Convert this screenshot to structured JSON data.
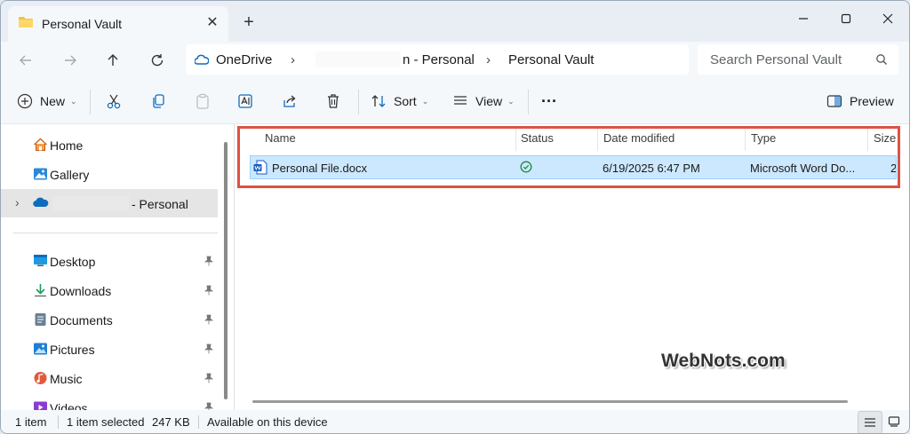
{
  "window": {
    "tab_title": "Personal Vault",
    "tab_close": "✕",
    "new_tab": "+",
    "controls": {
      "minimize": "minimize-icon",
      "maximize": "maximize-icon",
      "close": "close-icon"
    }
  },
  "address": {
    "root": "OneDrive",
    "segment2_suffix": "n - Personal",
    "current": "Personal Vault",
    "separator": "›"
  },
  "search": {
    "placeholder": "Search Personal Vault"
  },
  "toolbar": {
    "new_label": "New",
    "sort_label": "Sort",
    "view_label": "View",
    "more_label": "···",
    "preview_label": "Preview",
    "chevron": "⌄"
  },
  "nav": {
    "expander": "›",
    "items": [
      {
        "label": "Home",
        "icon": "home-icon"
      },
      {
        "label": "Gallery",
        "icon": "gallery-icon"
      },
      {
        "label": "- Personal",
        "icon": "onedrive-cloud-icon"
      },
      {
        "label": "Desktop",
        "icon": "desktop-icon"
      },
      {
        "label": "Downloads",
        "icon": "downloads-icon"
      },
      {
        "label": "Documents",
        "icon": "documents-icon"
      },
      {
        "label": "Pictures",
        "icon": "pictures-icon"
      },
      {
        "label": "Music",
        "icon": "music-icon"
      },
      {
        "label": "Videos",
        "icon": "videos-icon"
      }
    ]
  },
  "columns": {
    "name": "Name",
    "status": "Status",
    "date": "Date modified",
    "type": "Type",
    "size": "Size"
  },
  "files": [
    {
      "name": "Personal File.docx",
      "status_icon": "available-check-icon",
      "date": "6/19/2025 6:47 PM",
      "type": "Microsoft Word Do...",
      "size_fragment": "2"
    }
  ],
  "watermark": "WebNots.com",
  "status": {
    "count": "1 item",
    "selected": "1 item selected",
    "size": "247 KB",
    "availability": "Available on this device"
  },
  "colors": {
    "selection": "#cce8ff",
    "highlight_box": "#dc5246",
    "onedrive_blue": "#0f6cbd"
  }
}
